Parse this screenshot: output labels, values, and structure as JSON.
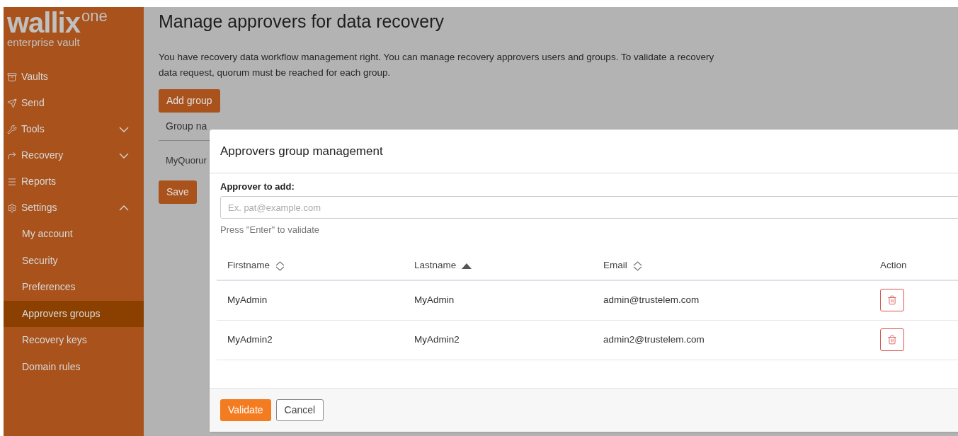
{
  "logo": {
    "brand": "wallix",
    "suffix": "one",
    "tagline": "enterprise vault"
  },
  "sidebar": {
    "items": [
      {
        "label": "Vaults"
      },
      {
        "label": "Send"
      },
      {
        "label": "Tools",
        "expanded": false
      },
      {
        "label": "Recovery",
        "expanded": false
      },
      {
        "label": "Reports"
      },
      {
        "label": "Settings",
        "expanded": true,
        "children": [
          {
            "label": "My account",
            "selected": false
          },
          {
            "label": "Security",
            "selected": false
          },
          {
            "label": "Preferences",
            "selected": false
          },
          {
            "label": "Approvers groups",
            "selected": true
          },
          {
            "label": "Recovery keys",
            "selected": false
          },
          {
            "label": "Domain rules",
            "selected": false
          }
        ]
      }
    ]
  },
  "page": {
    "title": "Manage approvers for data recovery",
    "description": "You have recovery data workflow management right. You can manage recovery approvers users and groups. To validate a recovery data request, quorum must be reached for each group.",
    "add_button": "Add group",
    "table": {
      "column_1": "Group na",
      "row_1": "MyQuorur"
    },
    "save_button": "Save"
  },
  "modal": {
    "title": "Approvers group management",
    "field_label": "Approver to add:",
    "placeholder": "Ex. pat@example.com",
    "hint": "Press \"Enter\" to validate",
    "columns": [
      {
        "label": "Firstname",
        "kind": "sortable",
        "sorted": false
      },
      {
        "label": "Lastname",
        "kind": "sortable",
        "sorted": true
      },
      {
        "label": "Email",
        "kind": "sortable",
        "sorted": false
      },
      {
        "label": "Action",
        "kind": "plain"
      }
    ],
    "rows": [
      {
        "firstname": "MyAdmin",
        "lastname": "MyAdmin",
        "email": "admin@trustelem.com"
      },
      {
        "firstname": "MyAdmin2",
        "lastname": "MyAdmin2",
        "email": "admin2@trustelem.com"
      }
    ],
    "validate_button": "Validate",
    "cancel_button": "Cancel"
  }
}
